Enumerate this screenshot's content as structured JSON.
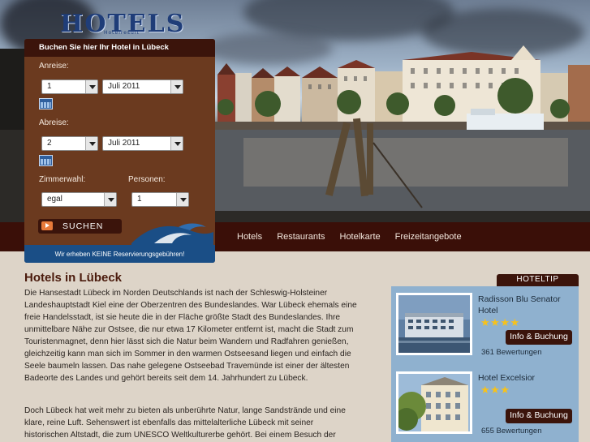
{
  "brand": {
    "logo": "HOTELS",
    "logo_sub": "Hotelresult"
  },
  "booking": {
    "title": "Buchen Sie hier Ihr Hotel in Lübeck",
    "arrival_label": "Anreise:",
    "arrival_day": "1",
    "arrival_month": "Juli 2011",
    "departure_label": "Abreise:",
    "departure_day": "2",
    "departure_month": "Juli 2011",
    "room_label": "Zimmerwahl:",
    "room_value": "egal",
    "persons_label": "Personen:",
    "persons_value": "1",
    "search_label": "SUCHEN",
    "footer": "Wir erheben KEINE Reservierungsgebühren!"
  },
  "nav": {
    "items": [
      "Hotels",
      "Restaurants",
      "Hotelkarte",
      "Freizeitangebote"
    ]
  },
  "main": {
    "title": "Hotels in Lübeck",
    "paragraph1": "Die Hansestadt Lübeck im Norden Deutschlands ist nach der Schleswig-Holsteiner Landeshauptstadt Kiel eine der Oberzentren des Bundeslandes. War Lübeck ehemals eine freie Handelsstadt, ist sie heute die in der Fläche größte Stadt des Bundeslandes. Ihre unmittelbare Nähe zur Ostsee, die nur etwa 17 Kilometer entfernt ist, macht die Stadt zum Touristenmagnet, denn hier lässt sich die Natur beim Wandern und Radfahren genießen, gleichzeitig kann man sich im Sommer in den warmen Ostseesand liegen und einfach die Seele baumeln lassen. Das nahe gelegene Ostseebad Travemünde ist einer der ältesten Badeorte des Landes und gehört bereits seit dem 14. Jahrhundert zu Lübeck.",
    "paragraph2": "Doch Lübeck hat weit mehr zu bieten als unberührte Natur, lange Sandstrände und eine klare, reine Luft. Sehenswert ist ebenfalls das mittelalterliche Lübeck mit seiner historischen Altstadt, die zum UNESCO Weltkulturerbe gehört. Bei einem Besuch der"
  },
  "hoteltip": {
    "header": "HOTELTIP",
    "hotels": [
      {
        "name": "Radisson Blu Senator Hotel",
        "stars": 4,
        "button": "Info & Buchung",
        "reviews": "361 Bewertungen"
      },
      {
        "name": "Hotel Excelsior",
        "stars": 3,
        "button": "Info & Buchung",
        "reviews": "655 Bewertungen"
      }
    ]
  },
  "colors": {
    "dark_brown": "#3b140b",
    "widget_brown": "#6b3a1f",
    "panel_blue": "#8fb1cf",
    "star": "#f7c21a"
  },
  "icons": [
    "calendar-icon",
    "dropdown-arrow-icon",
    "play-arrow-icon",
    "star-icon",
    "wave-logo-icon"
  ]
}
